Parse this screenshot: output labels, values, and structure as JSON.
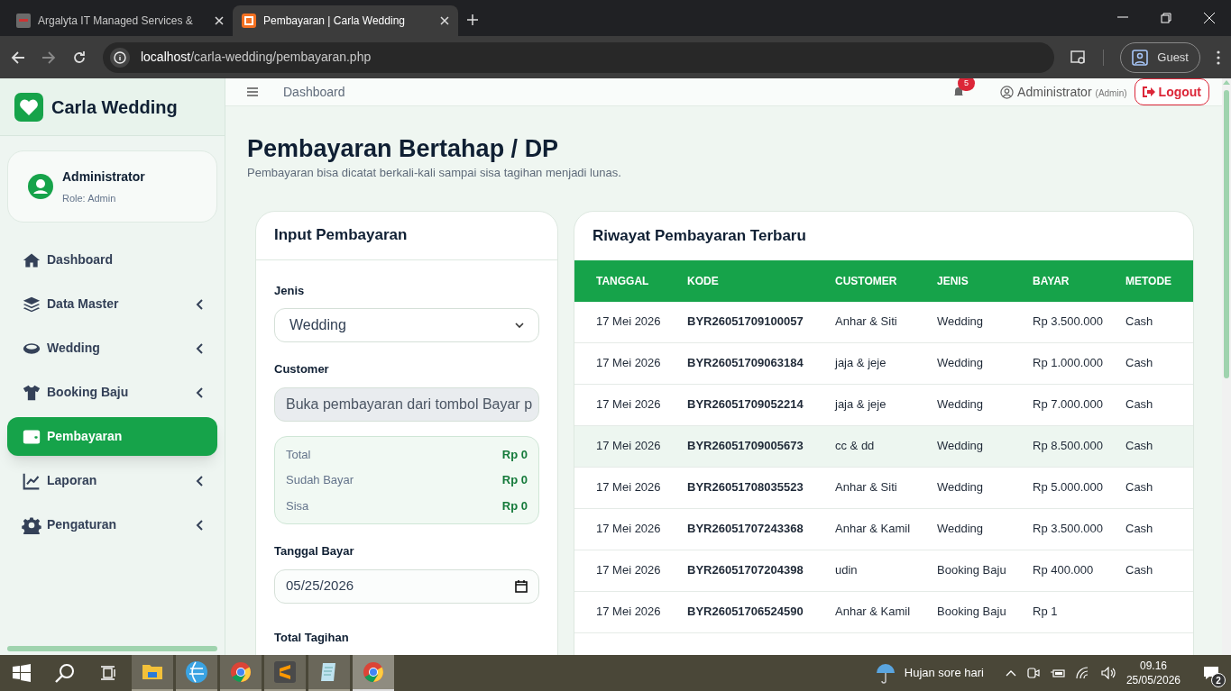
{
  "browser": {
    "tabs": [
      {
        "title": "Argalyta IT Managed Services &",
        "kind": "gray",
        "selected": false
      },
      {
        "title": "Pembayaran | Carla Wedding",
        "kind": "orange",
        "selected": true
      }
    ],
    "url_host": "localhost",
    "url_path": "/carla-wedding/pembayaran.php",
    "profile": "Guest"
  },
  "sidebar": {
    "brand": "Carla Wedding",
    "user": {
      "name": "Administrator",
      "role": "Role: Admin"
    },
    "nav": [
      {
        "label": "Dashboard",
        "kind": "home",
        "submenu": false,
        "selected": false
      },
      {
        "label": "Data Master",
        "kind": "layers",
        "submenu": true,
        "selected": false
      },
      {
        "label": "Wedding",
        "kind": "ring",
        "submenu": true,
        "selected": false
      },
      {
        "label": "Booking Baju",
        "kind": "shirt",
        "submenu": true,
        "selected": false
      },
      {
        "label": "Pembayaran",
        "kind": "wallet",
        "submenu": false,
        "selected": true
      },
      {
        "label": "Laporan",
        "kind": "chart",
        "submenu": true,
        "selected": false
      },
      {
        "label": "Pengaturan",
        "kind": "gear",
        "submenu": true,
        "selected": false
      }
    ]
  },
  "topbar": {
    "breadcrumb": "Dashboard",
    "notifications": "5",
    "user": "Administrator",
    "role": "(Admin)",
    "logout": "Logout"
  },
  "page": {
    "title": "Pembayaran Bertahap / DP",
    "subtitle": "Pembayaran bisa dicatat berkali-kali sampai sisa tagihan menjadi lunas."
  },
  "form": {
    "title": "Input Pembayaran",
    "jenis": {
      "label": "Jenis",
      "value": "Wedding"
    },
    "customer": {
      "label": "Customer",
      "value": "Buka pembayaran dari tombol Bayar p"
    },
    "summary": [
      {
        "label": "Total",
        "value": "Rp 0"
      },
      {
        "label": "Sudah Bayar",
        "value": "Rp 0"
      },
      {
        "label": "Sisa",
        "value": "Rp 0"
      }
    ],
    "tanggal": {
      "label": "Tanggal Bayar",
      "value": "05/25/2026"
    },
    "next_label": "Total Tagihan"
  },
  "table": {
    "title": "Riwayat Pembayaran Terbaru",
    "columns": [
      "TANGGAL",
      "KODE",
      "CUSTOMER",
      "JENIS",
      "BAYAR",
      "METODE"
    ],
    "rows": [
      {
        "tanggal": "17 Mei 2026",
        "kode": "BYR26051709100057",
        "customer": "Anhar & Siti",
        "jenis": "Wedding",
        "bayar": "Rp 3.500.000",
        "metode": "Cash",
        "highlighted": false
      },
      {
        "tanggal": "17 Mei 2026",
        "kode": "BYR26051709063184",
        "customer": "jaja & jeje",
        "jenis": "Wedding",
        "bayar": "Rp 1.000.000",
        "metode": "Cash",
        "highlighted": false
      },
      {
        "tanggal": "17 Mei 2026",
        "kode": "BYR26051709052214",
        "customer": "jaja & jeje",
        "jenis": "Wedding",
        "bayar": "Rp 7.000.000",
        "metode": "Cash",
        "highlighted": false
      },
      {
        "tanggal": "17 Mei 2026",
        "kode": "BYR26051709005673",
        "customer": "cc & dd",
        "jenis": "Wedding",
        "bayar": "Rp 8.500.000",
        "metode": "Cash",
        "highlighted": true
      },
      {
        "tanggal": "17 Mei 2026",
        "kode": "BYR26051708035523",
        "customer": "Anhar & Siti",
        "jenis": "Wedding",
        "bayar": "Rp 5.000.000",
        "metode": "Cash",
        "highlighted": false
      },
      {
        "tanggal": "17 Mei 2026",
        "kode": "BYR26051707243368",
        "customer": "Anhar & Kamil",
        "jenis": "Wedding",
        "bayar": "Rp 3.500.000",
        "metode": "Cash",
        "highlighted": false
      },
      {
        "tanggal": "17 Mei 2026",
        "kode": "BYR26051707204398",
        "customer": "udin",
        "jenis": "Booking Baju",
        "bayar": "Rp 400.000",
        "metode": "Cash",
        "highlighted": false
      },
      {
        "tanggal": "17 Mei 2026",
        "kode": "BYR26051706524590",
        "customer": "Anhar & Kamil",
        "jenis": "Booking Baju",
        "bayar": "Rp 1",
        "highlighted": false
      }
    ]
  },
  "taskbar": {
    "apps": [
      {
        "kind": "explorer",
        "active": false
      },
      {
        "kind": "globe",
        "active": false
      },
      {
        "kind": "chrome",
        "active": false
      },
      {
        "kind": "sublime",
        "active": false
      },
      {
        "kind": "notepad",
        "active": false
      },
      {
        "kind": "chrome",
        "active": true
      }
    ],
    "weather": "Hujan sore hari",
    "time": "09.16",
    "date": "25/05/2026",
    "notifications": "2"
  }
}
